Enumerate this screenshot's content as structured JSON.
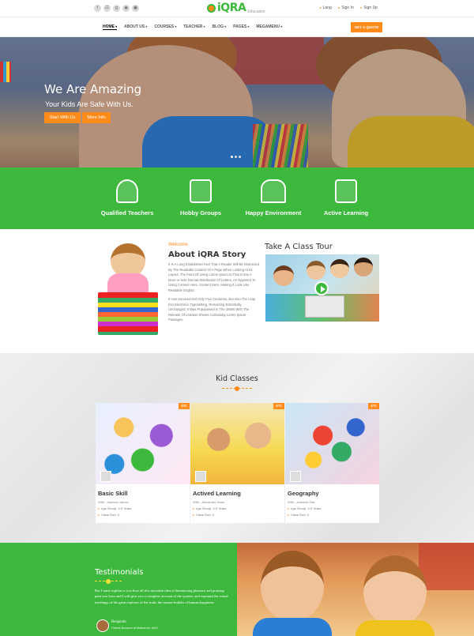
{
  "topbar": {
    "social_icons": [
      "f",
      "rss",
      "g+",
      "dribbble",
      "instagram"
    ],
    "logo_text": "iQRA",
    "logo_sub": "Education",
    "lang": "Lang",
    "signin": "Sign In",
    "signup": "Sign Up"
  },
  "nav": {
    "items": [
      "HOME",
      "ABOUT US",
      "COURSES",
      "TEACHER",
      "BLOG",
      "PAGES",
      "MEGAMENU"
    ],
    "cta": "GET A QUOTE"
  },
  "hero": {
    "title": "We Are Amazing",
    "subtitle": "Your Kids Are Safe With Us.",
    "btn_primary": "Start With Us",
    "btn_secondary": "More Info",
    "slide_dots": 3,
    "active_slide": 1
  },
  "features": [
    {
      "label": "Qualified Teachers",
      "icon": "teacher-icon"
    },
    {
      "label": "Hobby Groups",
      "icon": "puzzle-icon"
    },
    {
      "label": "Happy Environment",
      "icon": "school-icon"
    },
    {
      "label": "Active Learning",
      "icon": "abc-blocks-icon"
    }
  ],
  "about": {
    "welcome": "Welcome",
    "title": "About iQRA Story",
    "p1": "It Is A Long Established Fact That A Reader Will Be Distracted By The Readable Content Of A Page When Looking At Its Layout. The Point Of Using Lorem Ipsum Is That It Has A More-or-less Normal Distribution Of Letters, As Opposed To Using Content Here, Content Here, Making It Look Like Readable English.",
    "p2": "It Has Survived Not Only Five Centuries, But Also The Leap Into Electronic Typesetting, Remaining Essentially Unchanged. It Was Popularised In The 1960s With The Release Of Letraset Sheets Containing Lorem Ipsum Passages."
  },
  "tour": {
    "title": "Take A Class Tour"
  },
  "classes": {
    "title": "Kid Classes",
    "cards": [
      {
        "title": "Basic Skill",
        "with": "With - Marison James",
        "age": "Age Group: 3-5 Years",
        "size": "Class Size: 5",
        "price": "$35"
      },
      {
        "title": "Actived Learning",
        "with": "With - Alexander Haas",
        "age": "Age Group: 3-5 Years",
        "size": "Class Size: 5",
        "price": "$75"
      },
      {
        "title": "Geography",
        "with": "With - Arabella Star",
        "age": "Age Group: 3-5 Years",
        "size": "Class Size: 5",
        "price": "$75"
      }
    ]
  },
  "testimonials": {
    "title": "Testimonials",
    "text": "But I must explain to you how all this mistaken idea of denouncing pleasure and praising pain was born and I will give you a complete account of the system, and expound the actual teachings of the great explorer of the truth, the master-builder of human happiness",
    "name": "Benjamin",
    "role": "Fedrus Bonsom at Malborum, AUS"
  },
  "colors": {
    "accent": "#ff8c1a",
    "brand_green": "#3cb93c"
  }
}
